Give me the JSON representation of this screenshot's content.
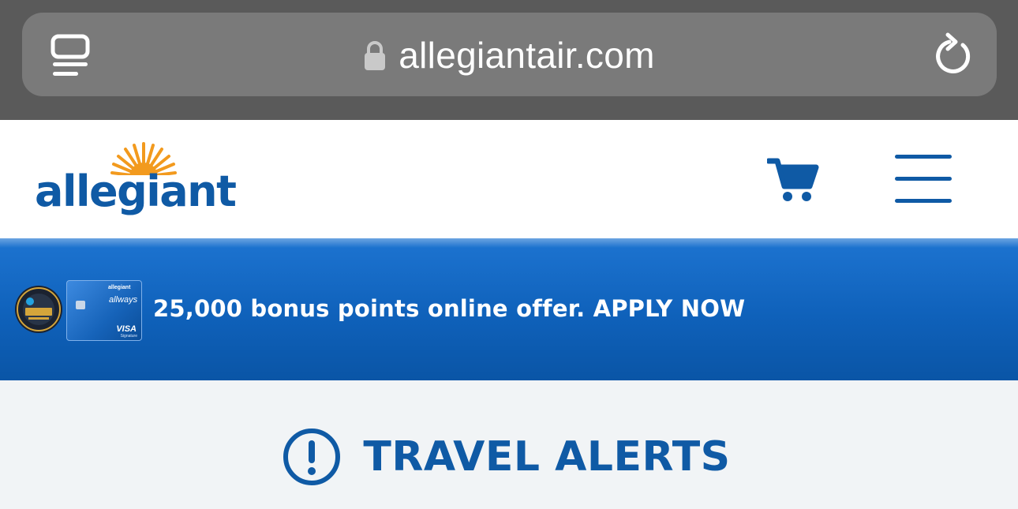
{
  "browser": {
    "url": "allegiantair.com",
    "icons": {
      "tabs": "tabs-overview-icon",
      "lock": "lock-icon",
      "reload": "reload-icon"
    }
  },
  "header": {
    "logo_text": "allegiant",
    "icons": {
      "cart": "shopping-cart-icon",
      "menu": "hamburger-menu-icon"
    }
  },
  "promo": {
    "text": "25,000 bonus points online offer. APPLY NOW",
    "card": {
      "brand": "allegiant",
      "name": "allways",
      "network": "VISA",
      "tier": "Signature"
    },
    "badge_icon": "usa-today-readers-choice-badge"
  },
  "alerts": {
    "title": "TRAVEL ALERTS",
    "icon": "exclamation-circle-icon"
  },
  "colors": {
    "brand_blue": "#0f5aa5",
    "promo_blue": "#1364bf",
    "sun_orange": "#f29a1e",
    "browser_gray": "#5a5a5a"
  }
}
